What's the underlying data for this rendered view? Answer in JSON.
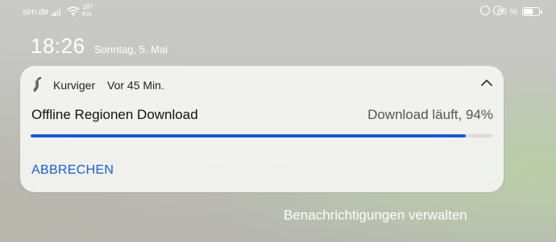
{
  "status_bar": {
    "carrier": "sim.de",
    "net_speed_value": "187",
    "net_speed_unit": "K/s",
    "battery_percent": "65 %",
    "battery_level": 0.65,
    "icons": [
      "signal-icon",
      "wifi-icon",
      "hotspot-icon",
      "alarm-icon",
      "battery-icon"
    ]
  },
  "lockscreen": {
    "time": "18:26",
    "date": "Sonntag, 5. Mai"
  },
  "notification": {
    "app_name": "Kurviger",
    "time_ago": "Vor 45 Min.",
    "title": "Offline Regionen Download",
    "status": "Download läuft, 94%",
    "progress": 0.94,
    "action_label": "ABBRECHEN",
    "accent_color": "#1a5bd6"
  },
  "footer": {
    "manage_label": "Benachrichtigungen verwalten"
  }
}
